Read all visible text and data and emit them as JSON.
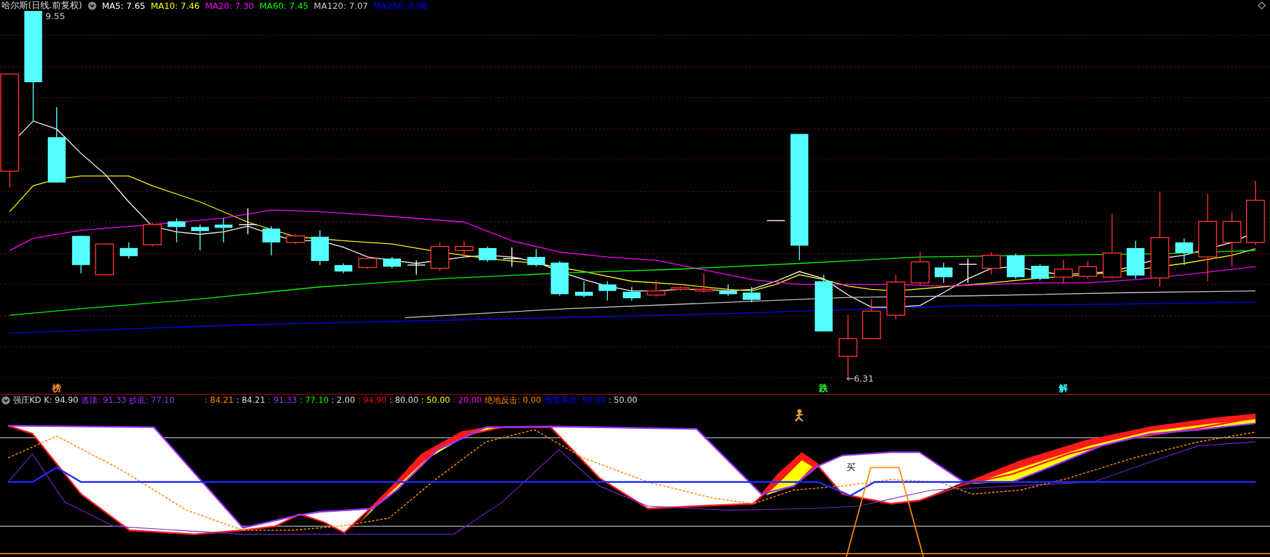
{
  "main_chart": {
    "title": "哈尔斯(日线.前复权)",
    "ma_legend": [
      {
        "text": "MA5: 7.65",
        "color": "#ffffff"
      },
      {
        "text": "MA10: 7.46",
        "color": "#ffff00"
      },
      {
        "text": "MA20: 7.30",
        "color": "#ff00ff"
      },
      {
        "text": "MA60: 7.45",
        "color": "#00ff00"
      },
      {
        "text": "MA120: 7.07",
        "color": "#c8c8c8"
      },
      {
        "text": "MA250: 6.98",
        "color": "#0000ff"
      }
    ],
    "high_label": "9.55",
    "low_label": "←6.31",
    "signals": [
      {
        "text": "榜",
        "color": "#ff9933"
      },
      {
        "text": "跌",
        "color": "#33ff33"
      },
      {
        "text": "解",
        "color": "#33ffff"
      }
    ]
  },
  "indicator": {
    "name": "强庄KD",
    "legend": [
      {
        "text": "K: 94.90",
        "color": "#dddddd"
      },
      {
        "text": "逃顶: 91.33",
        "color": "#9933ff"
      },
      {
        "text": "抄底: 77.10",
        "color": "#9933ff"
      },
      {
        "text": ": 84.21",
        "color": "#ff8800"
      },
      {
        "text": ": 84.21",
        "color": "#dddddd"
      },
      {
        "text": ": 91.33",
        "color": "#9933ff"
      },
      {
        "text": ": 77.10",
        "color": "#00ff00"
      },
      {
        "text": ": 2.00",
        "color": "#dddddd"
      },
      {
        "text": ": 94.90",
        "color": "#ff0000"
      },
      {
        "text": ": 80.00",
        "color": "#dddddd"
      },
      {
        "text": ": 50.00",
        "color": "#ffff00"
      },
      {
        "text": ": 20.00",
        "color": "#ff00ff"
      },
      {
        "text": "绝地反击: 0.00",
        "color": "#ff8800"
      },
      {
        "text": "预警系统: 50.00",
        "color": "#0000ff"
      },
      {
        "text": ": 50.00",
        "color": "#dddddd"
      }
    ],
    "buy_label": "买"
  }
}
